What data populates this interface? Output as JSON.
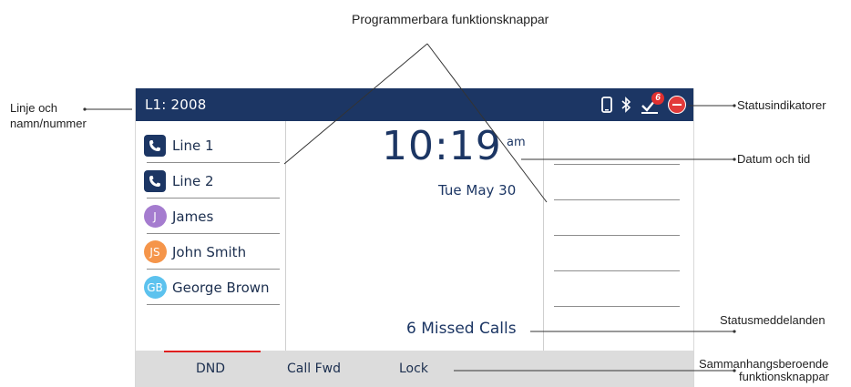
{
  "status_bar": {
    "line_label": "L1: 2008",
    "icons": [
      "mobile-icon",
      "bluetooth-icon",
      "voicemail-icon",
      "dnd-status-icon"
    ],
    "voicemail_count": "6"
  },
  "line_list": [
    {
      "type": "line",
      "label": "Line 1",
      "icon": "phone-icon"
    },
    {
      "type": "line",
      "label": "Line 2",
      "icon": "phone-icon"
    },
    {
      "type": "contact",
      "initials": "J",
      "label": "James",
      "color": "#a57ccf"
    },
    {
      "type": "contact",
      "initials": "JS",
      "label": "John Smith",
      "color": "#f5954a"
    },
    {
      "type": "contact",
      "initials": "GB",
      "label": "George Brown",
      "color": "#5cc2ee"
    }
  ],
  "clock": {
    "time": "10:19",
    "ampm": "am",
    "date": "Tue May 30"
  },
  "status_message": "6  Missed Calls",
  "softkeys": [
    "DND",
    "Call Fwd",
    "Lock"
  ],
  "annotations": {
    "programmable_keys": "Programmerbara funktionsknappar",
    "line_and_name_1": "Linje och",
    "line_and_name_2": "namn/nummer",
    "status_indicators": "Statusindikatorer",
    "date_and_time": "Datum och tid",
    "status_messages": "Statusmeddelanden",
    "context_keys_1": "Sammanhangsberoende",
    "context_keys_2": "funktionsknappar"
  },
  "colors": {
    "status_bar": "#1c3664",
    "softkey_bar": "#dcdcdc",
    "active_indicator": "#e02020"
  }
}
